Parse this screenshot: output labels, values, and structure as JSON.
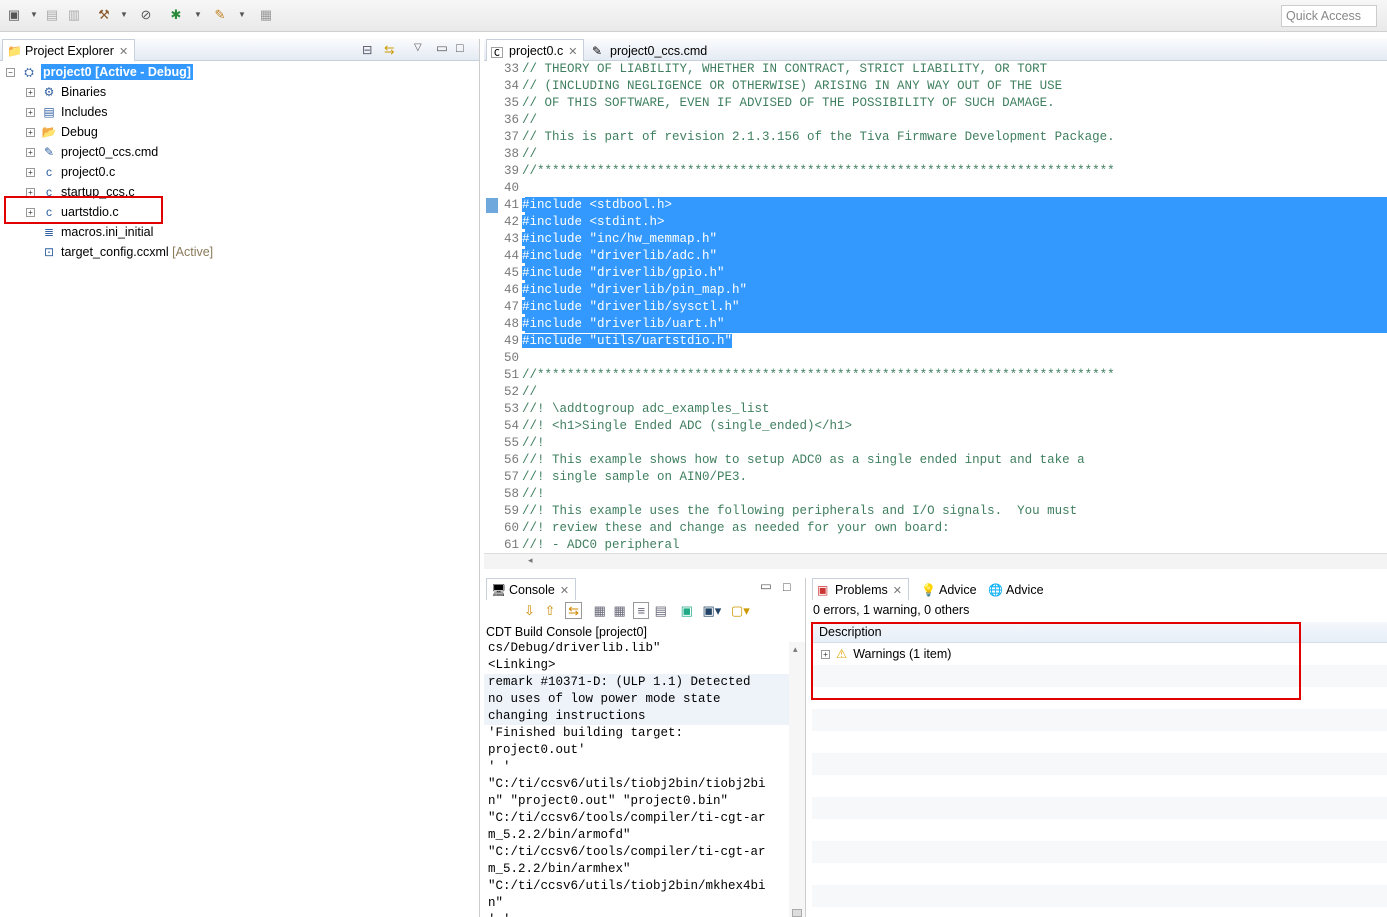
{
  "toolbar": {
    "icons": [
      "new-icon",
      "save-icon",
      "save-all-icon",
      "build-hammer-icon",
      "search-icon",
      "debug-bug-icon",
      "flashlight-icon",
      "view-icon"
    ],
    "quick_access_placeholder": "Quick Access"
  },
  "explorer": {
    "tab_label": "Project Explorer",
    "project": "project0  [Active - Debug]",
    "items": [
      {
        "label": "Binaries",
        "icon": "binaries-icon",
        "expandable": true
      },
      {
        "label": "Includes",
        "icon": "includes-icon",
        "expandable": true
      },
      {
        "label": "Debug",
        "icon": "folder-icon",
        "expandable": true
      },
      {
        "label": "project0_ccs.cmd",
        "icon": "cmd-file-icon",
        "expandable": true
      },
      {
        "label": "project0.c",
        "icon": "c-file-icon",
        "expandable": true
      },
      {
        "label": "startup_ccs.c",
        "icon": "c-file-icon",
        "expandable": true
      },
      {
        "label": "uartstdio.c",
        "icon": "c-file-icon",
        "expandable": true
      },
      {
        "label": "macros.ini_initial",
        "icon": "text-file-icon",
        "expandable": false
      },
      {
        "label": "target_config.ccxml",
        "icon": "config-file-icon",
        "expandable": false,
        "suffix": "[Active]"
      }
    ]
  },
  "editor": {
    "tabs": [
      "project0.c",
      "project0_ccs.cmd"
    ],
    "lines": [
      {
        "n": "33",
        "t": "// THEORY OF LIABILITY, WHETHER IN CONTRACT, STRICT LIABILITY, OR TORT"
      },
      {
        "n": "34",
        "t": "// (INCLUDING NEGLIGENCE OR OTHERWISE) ARISING IN ANY WAY OUT OF THE USE"
      },
      {
        "n": "35",
        "t": "// OF THIS SOFTWARE, EVEN IF ADVISED OF THE POSSIBILITY OF SUCH DAMAGE."
      },
      {
        "n": "36",
        "t": "//"
      },
      {
        "n": "37",
        "t": "// This is part of revision 2.1.3.156 of the Tiva Firmware Development Package."
      },
      {
        "n": "38",
        "t": "//"
      },
      {
        "n": "39",
        "t": "//*****************************************************************************"
      },
      {
        "n": "40",
        "t": ""
      },
      {
        "n": "41",
        "t": "#include <stdbool.h>",
        "sel": true
      },
      {
        "n": "42",
        "t": "#include <stdint.h>",
        "sel": true
      },
      {
        "n": "43",
        "t": "#include \"inc/hw_memmap.h\"",
        "sel": true
      },
      {
        "n": "44",
        "t": "#include \"driverlib/adc.h\"",
        "sel": true
      },
      {
        "n": "45",
        "t": "#include \"driverlib/gpio.h\"",
        "sel": true
      },
      {
        "n": "46",
        "t": "#include \"driverlib/pin_map.h\"",
        "sel": true
      },
      {
        "n": "47",
        "t": "#include \"driverlib/sysctl.h\"",
        "sel": true
      },
      {
        "n": "48",
        "t": "#include \"driverlib/uart.h\"",
        "sel": true
      },
      {
        "n": "49",
        "t": "#include \"utils/uartstdio.h\"",
        "sel": "partial"
      },
      {
        "n": "50",
        "t": ""
      },
      {
        "n": "51",
        "t": "//*****************************************************************************"
      },
      {
        "n": "52",
        "t": "//"
      },
      {
        "n": "53",
        "t": "//! \\addtogroup adc_examples_list"
      },
      {
        "n": "54",
        "t": "//! <h1>Single Ended ADC (single_ended)</h1>"
      },
      {
        "n": "55",
        "t": "//!"
      },
      {
        "n": "56",
        "t": "//! This example shows how to setup ADC0 as a single ended input and take a"
      },
      {
        "n": "57",
        "t": "//! single sample on AIN0/PE3."
      },
      {
        "n": "58",
        "t": "//!"
      },
      {
        "n": "59",
        "t": "//! This example uses the following peripherals and I/O signals.  You must"
      },
      {
        "n": "60",
        "t": "//! review these and change as needed for your own board:"
      },
      {
        "n": "61",
        "t": "//! - ADC0 peripheral"
      }
    ]
  },
  "console": {
    "tab_label": "Console",
    "title": "CDT Build Console [project0]",
    "lines": [
      "cs/Debug/driverlib.lib\"",
      "<Linking>",
      "remark #10371-D: (ULP 1.1) Detected",
      "no uses of low power mode state",
      "changing instructions",
      "'Finished building target:",
      "project0.out'",
      "' '",
      "\"C:/ti/ccsv6/utils/tiobj2bin/tiobj2bi",
      "n\" \"project0.out\" \"project0.bin\"",
      "\"C:/ti/ccsv6/tools/compiler/ti-cgt-ar",
      "m_5.2.2/bin/armofd\"",
      "\"C:/ti/ccsv6/tools/compiler/ti-cgt-ar",
      "m_5.2.2/bin/armhex\"",
      "\"C:/ti/ccsv6/utils/tiobj2bin/mkhex4bi",
      "n\"",
      "' '"
    ]
  },
  "problems": {
    "tabs": [
      "Problems",
      "Advice",
      "Advice"
    ],
    "summary": "0 errors, 1 warning, 0 others",
    "column": "Description",
    "rows": [
      {
        "label": "Warnings (1 item)"
      }
    ]
  },
  "colors": {
    "selection": "#3399ff",
    "highlight_box": "#e00000",
    "comment": "#3f7f5f"
  }
}
